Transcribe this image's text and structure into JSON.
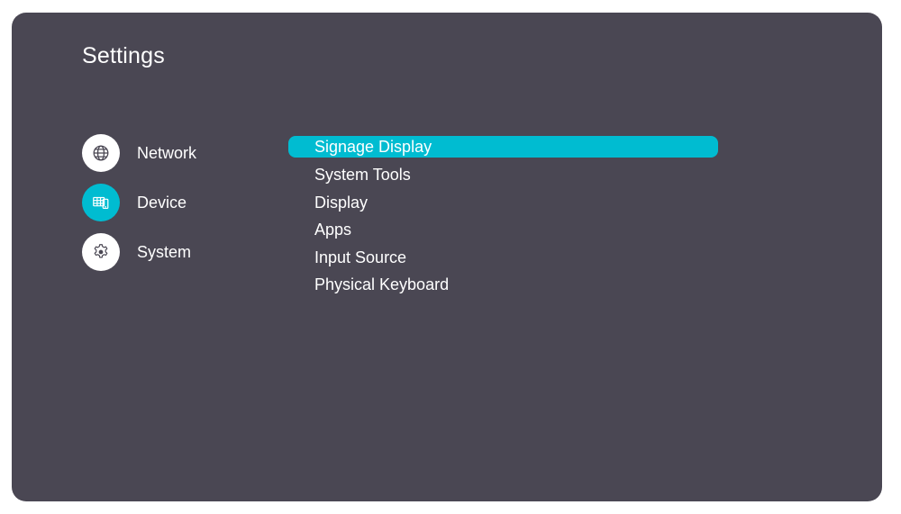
{
  "header": {
    "title": "Settings"
  },
  "categories": [
    {
      "id": "network",
      "label": "Network",
      "icon": "globe-icon",
      "active": false
    },
    {
      "id": "device",
      "label": "Device",
      "icon": "device-icon",
      "active": true
    },
    {
      "id": "system",
      "label": "System",
      "icon": "gear-icon",
      "active": false
    }
  ],
  "menu": {
    "items": [
      {
        "label": "Signage Display",
        "selected": true
      },
      {
        "label": "System Tools",
        "selected": false
      },
      {
        "label": "Display",
        "selected": false
      },
      {
        "label": "Apps",
        "selected": false
      },
      {
        "label": "Input Source",
        "selected": false
      },
      {
        "label": "Physical Keyboard",
        "selected": false
      }
    ]
  },
  "colors": {
    "background": "#4a4753",
    "accent": "#00bcd1",
    "text": "#ffffff",
    "icon_stroke": "#4a4753"
  }
}
